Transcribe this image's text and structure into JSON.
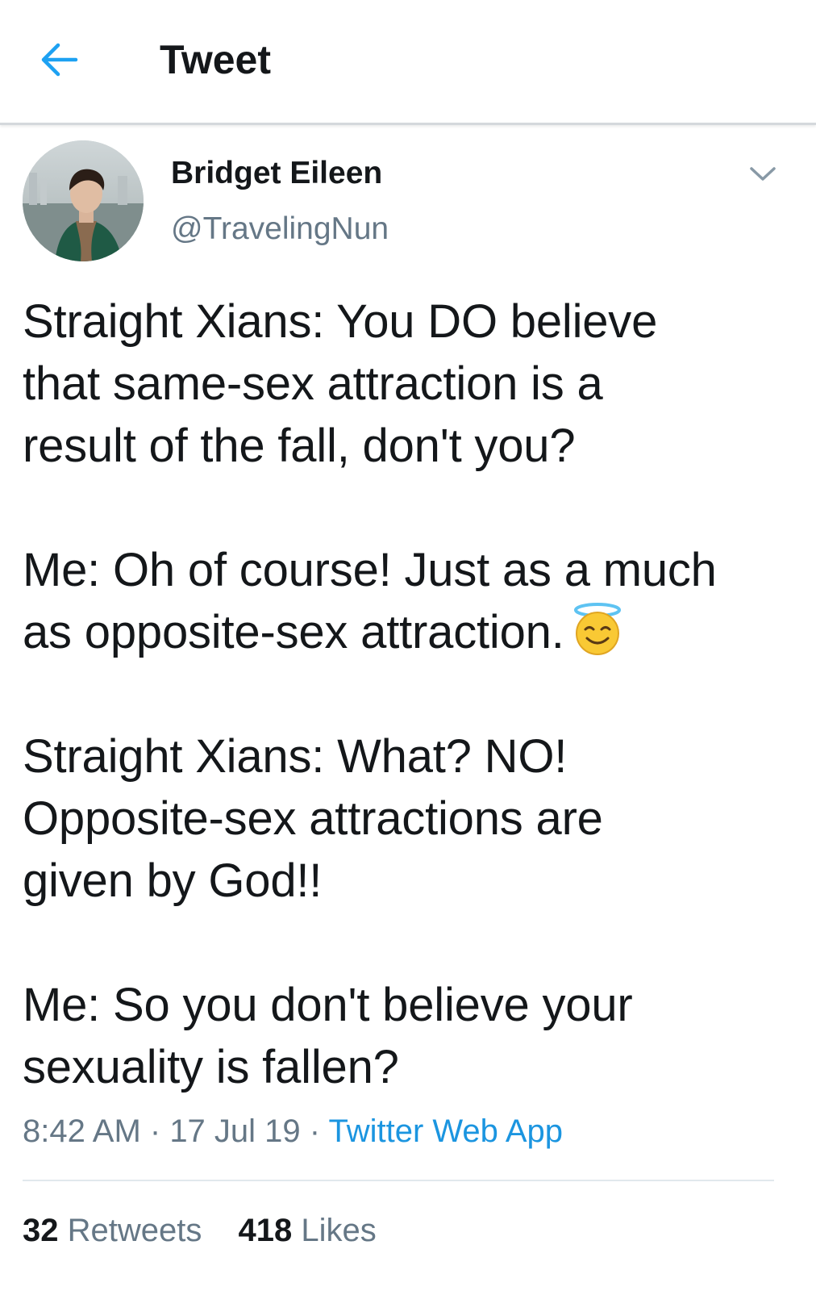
{
  "header": {
    "title": "Tweet",
    "back_icon": "back-arrow-icon",
    "accent_color": "#1da1f2"
  },
  "author": {
    "display_name": "Bridget Eileen",
    "handle": "@TravelingNun"
  },
  "tweet": {
    "paragraphs": [
      {
        "lines": [
          "Straight Xians: You DO believe",
          "that same-sex attraction is a",
          "result of the fall, don't you?"
        ]
      },
      {
        "lines": [
          "Me: Oh of course! Just as a much",
          "as opposite-sex attraction."
        ],
        "emoji": "smiling-face-with-halo-icon"
      },
      {
        "lines": [
          "Straight Xians: What? NO!",
          "Opposite-sex attractions are",
          "given by God!!"
        ]
      },
      {
        "lines": [
          "Me: So you don't believe your",
          "sexuality is fallen?"
        ]
      }
    ],
    "time": "8:42 AM",
    "date": "17 Jul 19",
    "separator": " · ",
    "source": "Twitter Web App",
    "source_color": "#1b95e0"
  },
  "stats": {
    "retweets_count": "32",
    "retweets_label": "Retweets",
    "likes_count": "418",
    "likes_label": "Likes"
  }
}
